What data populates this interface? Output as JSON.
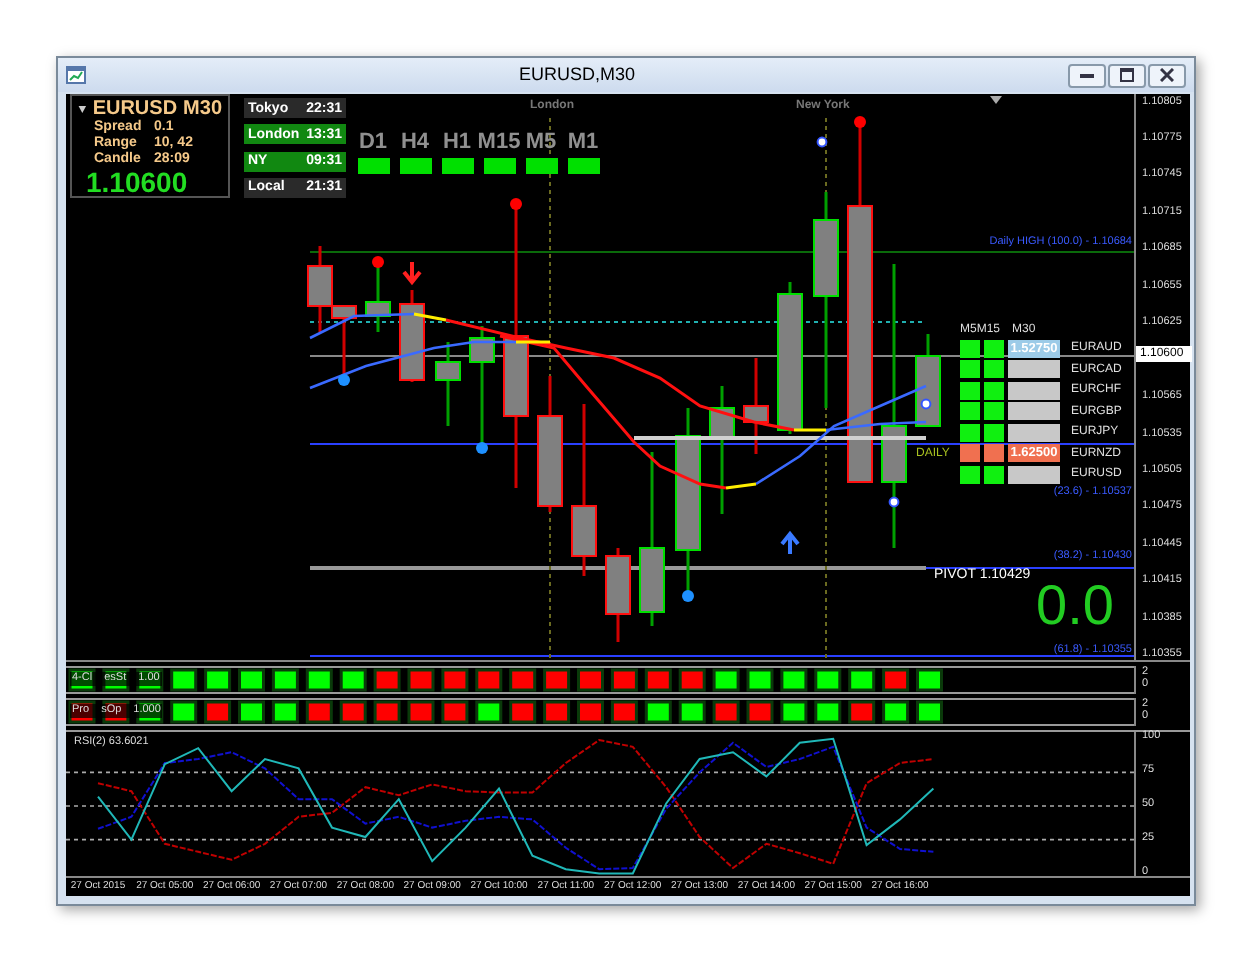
{
  "window": {
    "title": "EURUSD,M30"
  },
  "info_panel": {
    "symbol": "EURUSD",
    "timeframe": "M30",
    "rows": [
      {
        "label": "Spread",
        "value": "0.1"
      },
      {
        "label": "Range",
        "value": "10, 42"
      },
      {
        "label": "Candle",
        "value": "28:09"
      }
    ],
    "price": "1.10600"
  },
  "sessions": [
    {
      "name": "Tokyo",
      "time": "22:31",
      "active": false
    },
    {
      "name": "London",
      "time": "13:31",
      "active": true
    },
    {
      "name": "NY",
      "time": "09:31",
      "active": true
    },
    {
      "name": "Local",
      "time": "21:31",
      "active": false
    }
  ],
  "timeframes": [
    {
      "label": "D1",
      "color": "#00e000"
    },
    {
      "label": "H4",
      "color": "#00e000"
    },
    {
      "label": "H1",
      "color": "#00e000"
    },
    {
      "label": "M15",
      "color": "#00e000"
    },
    {
      "label": "M5",
      "color": "#00e000"
    },
    {
      "label": "M1",
      "color": "#00e000"
    }
  ],
  "session_markers": [
    "London",
    "New York"
  ],
  "levels": [
    {
      "label": "Daily HIGH (100.0) - 1.10684"
    },
    {
      "label": "(23.6) - 1.10537"
    },
    {
      "label": "(38.2) - 1.10430"
    },
    {
      "label": "(61.8) - 1.10355"
    }
  ],
  "daily_label": "DAILY",
  "pivot": "PIVOT 1.10429",
  "big_value": "0.0",
  "matrix": {
    "columns": [
      "M5M15",
      "M30"
    ],
    "rows": [
      {
        "symbol": "EURAUD",
        "signals": [
          {
            "color": "#10f010"
          },
          {
            "color": "#10f010"
          }
        ],
        "m30": {
          "value": "1.52750",
          "color": "#9ccbe8"
        }
      },
      {
        "symbol": "EURCAD",
        "signals": [
          {
            "color": "#10f010"
          },
          {
            "color": "#10f010"
          }
        ],
        "m30": {
          "color": "#c8c8c8"
        }
      },
      {
        "symbol": "EURCHF",
        "signals": [
          {
            "color": "#10f010"
          },
          {
            "color": "#10f010"
          }
        ],
        "m30": {
          "color": "#c8c8c8"
        }
      },
      {
        "symbol": "EURGBP",
        "signals": [
          {
            "color": "#10f010"
          },
          {
            "color": "#10f010"
          }
        ],
        "m30": {
          "color": "#c8c8c8"
        }
      },
      {
        "symbol": "EURJPY",
        "signals": [
          {
            "color": "#10f010"
          },
          {
            "color": "#10f010"
          }
        ],
        "m30": {
          "color": "#c8c8c8"
        }
      },
      {
        "symbol": "EURNZD",
        "signals": [
          {
            "color": "#f07050"
          },
          {
            "color": "#f07050"
          }
        ],
        "m30": {
          "value": "1.62500",
          "color": "#f07050"
        }
      },
      {
        "symbol": "EURUSD",
        "signals": [
          {
            "color": "#10f010"
          },
          {
            "color": "#10f010"
          }
        ],
        "m30": {
          "color": "#c8c8c8"
        }
      }
    ]
  },
  "price_axis": {
    "ticks": [
      "1.10805",
      "1.10775",
      "1.10745",
      "1.10715",
      "1.10685",
      "1.10655",
      "1.10625",
      "1.10565",
      "1.10535",
      "1.10505",
      "1.10475",
      "1.10445",
      "1.10415",
      "1.10385",
      "1.10355"
    ],
    "current": "1.10600"
  },
  "strips": [
    {
      "labels": [
        "4-Cl",
        "esSt",
        "1.00"
      ],
      "axis": [
        "2",
        "0"
      ],
      "cells": [
        {
          "color": "#00ff00"
        },
        {
          "color": "#00ff00"
        },
        {
          "color": "#00ff00"
        },
        {
          "color": "#00ff00"
        },
        {
          "color": "#00ff00"
        },
        {
          "color": "#00ff00"
        },
        {
          "color": "#00ff00"
        },
        {
          "color": "#00ff00"
        },
        {
          "color": "#00ff00"
        },
        {
          "color": "#ff0000"
        },
        {
          "color": "#ff0000"
        },
        {
          "color": "#ff0000"
        },
        {
          "color": "#ff0000"
        },
        {
          "color": "#ff0000"
        },
        {
          "color": "#ff0000"
        },
        {
          "color": "#ff0000"
        },
        {
          "color": "#ff0000"
        },
        {
          "color": "#ff0000"
        },
        {
          "color": "#ff0000"
        },
        {
          "color": "#00ff00"
        },
        {
          "color": "#00ff00"
        },
        {
          "color": "#00ff00"
        },
        {
          "color": "#00ff00"
        },
        {
          "color": "#00ff00"
        },
        {
          "color": "#ff0000"
        },
        {
          "color": "#00ff00"
        }
      ]
    },
    {
      "labels": [
        "Pro",
        "sOp",
        "1.000"
      ],
      "axis": [
        "2",
        "0"
      ],
      "cells": [
        {
          "color": "#ff0000"
        },
        {
          "color": "#ff0000"
        },
        {
          "color": "#00ff00"
        },
        {
          "color": "#00ff00"
        },
        {
          "color": "#ff0000"
        },
        {
          "color": "#00ff00"
        },
        {
          "color": "#00ff00"
        },
        {
          "color": "#ff0000"
        },
        {
          "color": "#ff0000"
        },
        {
          "color": "#ff0000"
        },
        {
          "color": "#ff0000"
        },
        {
          "color": "#ff0000"
        },
        {
          "color": "#00ff00"
        },
        {
          "color": "#ff0000"
        },
        {
          "color": "#ff0000"
        },
        {
          "color": "#ff0000"
        },
        {
          "color": "#ff0000"
        },
        {
          "color": "#00ff00"
        },
        {
          "color": "#00ff00"
        },
        {
          "color": "#ff0000"
        },
        {
          "color": "#ff0000"
        },
        {
          "color": "#00ff00"
        },
        {
          "color": "#00ff00"
        },
        {
          "color": "#ff0000"
        },
        {
          "color": "#00ff00"
        },
        {
          "color": "#00ff00"
        }
      ]
    }
  ],
  "rsi": {
    "label": "RSI(2) 63.6021",
    "chart_data": {
      "type": "line",
      "categories": [
        "27 Oct 2015",
        null,
        "27 Oct 05:00",
        null,
        "27 Oct 06:00",
        null,
        "27 Oct 07:00",
        null,
        "27 Oct 08:00",
        null,
        "27 Oct 09:00",
        null,
        "27 Oct 10:00",
        null,
        "27 Oct 11:00",
        null,
        "27 Oct 12:00",
        null,
        "27 Oct 13:00",
        null,
        "27 Oct 14:00",
        null,
        "27 Oct 15:00",
        null,
        "27 Oct 16:00",
        null,
        null,
        null,
        null,
        null,
        null
      ],
      "grid": true,
      "series": [
        {
          "color": "#20b8b8",
          "line_style": "solid",
          "values": [
            57,
            25,
            81,
            93,
            61,
            85,
            78,
            34,
            27,
            55,
            9,
            34,
            63,
            13,
            3,
            0,
            0,
            52,
            85,
            90,
            72,
            97,
            100,
            21,
            40,
            63,
            null,
            null,
            null,
            null,
            null
          ]
        },
        {
          "color": "#1010d0",
          "line_style": "dashed",
          "values": [
            33,
            42,
            82,
            85,
            90,
            78,
            55,
            55,
            37,
            42,
            34,
            39,
            42,
            40,
            19,
            3,
            4,
            48,
            75,
            97,
            79,
            85,
            94,
            34,
            18,
            16,
            null,
            null,
            null,
            null,
            null
          ]
        },
        {
          "color": "#c00000",
          "line_style": "dashed",
          "values": [
            67,
            61,
            22,
            16,
            10,
            22,
            42,
            45,
            64,
            58,
            66,
            61,
            60,
            60,
            82,
            99,
            94,
            64,
            27,
            4,
            22,
            15,
            7,
            67,
            82,
            85,
            null,
            null,
            null,
            null,
            null
          ]
        }
      ],
      "ylim": [
        -2,
        105
      ],
      "yticks": [
        0,
        25,
        50,
        75,
        100
      ]
    }
  }
}
